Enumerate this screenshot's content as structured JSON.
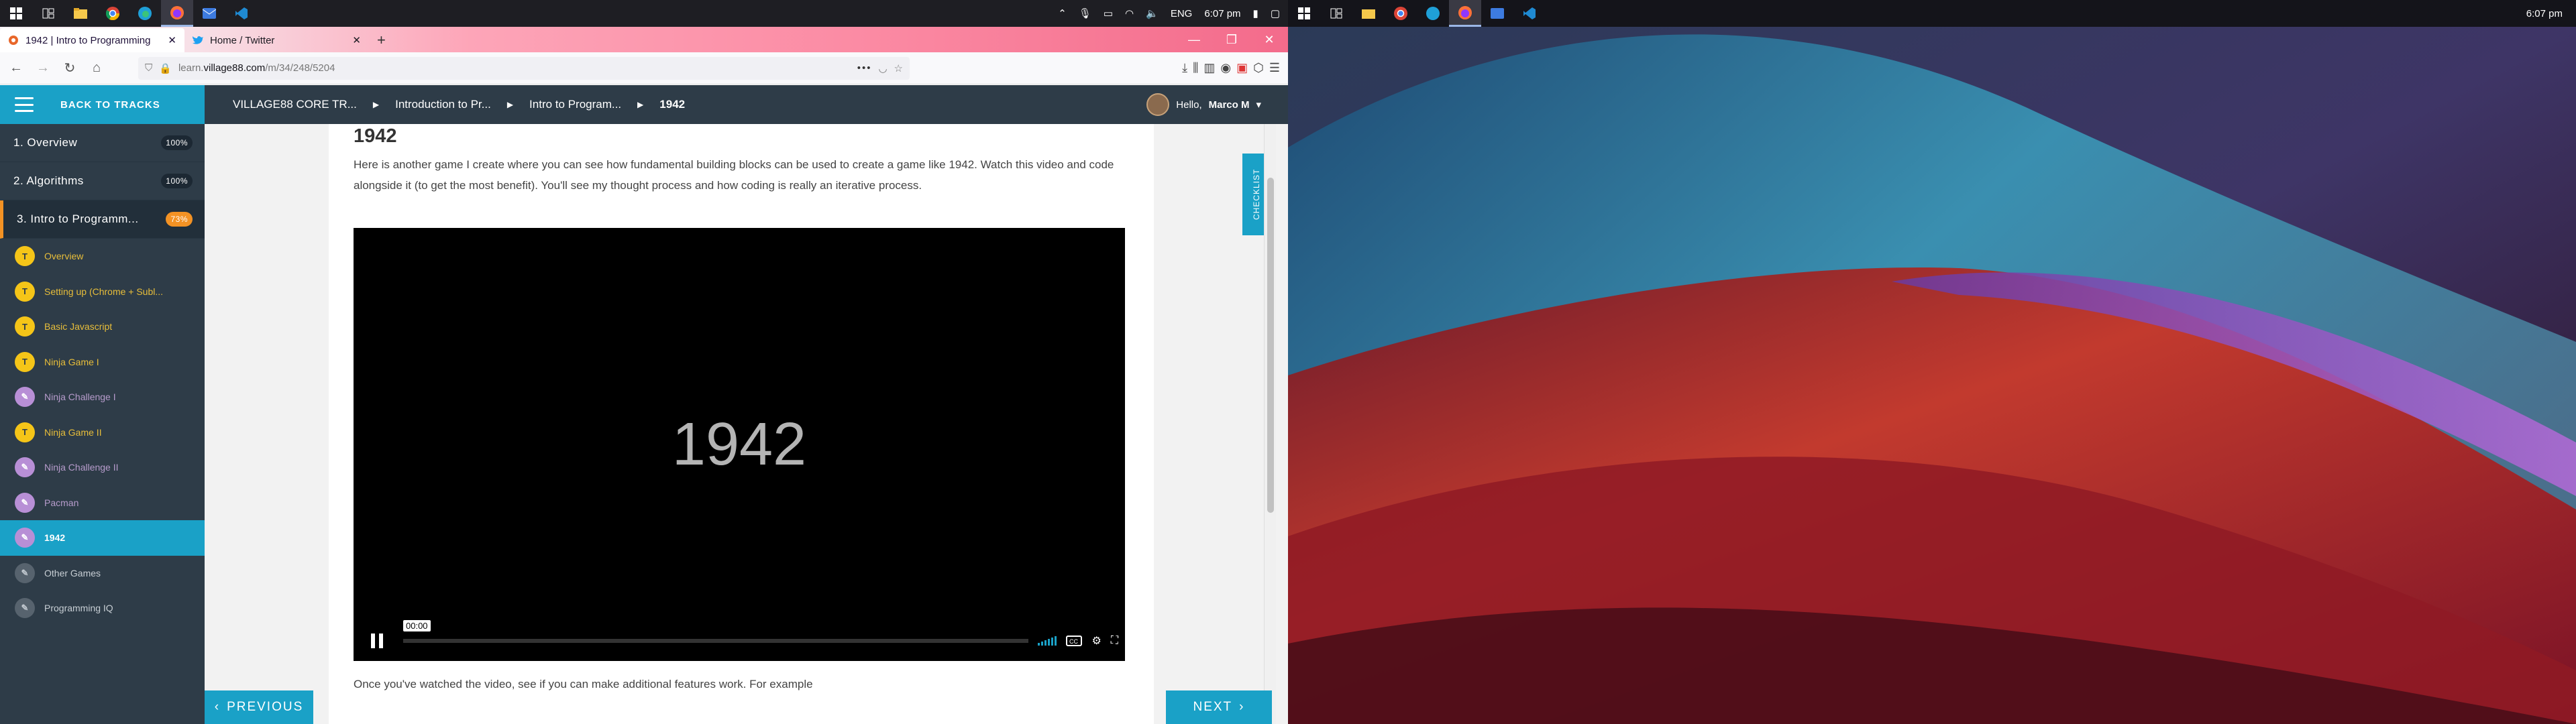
{
  "taskbar_left": {
    "apps": [
      "windows-icon",
      "task-view-icon",
      "file-explorer-icon",
      "chrome-icon",
      "edge-icon",
      "firefox-icon",
      "mail-icon",
      "vscode-icon"
    ],
    "lang": "ENG",
    "time": "6:07 pm"
  },
  "browser": {
    "tabs": [
      {
        "title": "1942 | Intro to Programming"
      },
      {
        "title": "Home / Twitter"
      }
    ],
    "url_prefix": "learn.",
    "url_host": "village88.com",
    "url_path": "/m/34/248/5204"
  },
  "sidebar": {
    "back_label": "BACK TO TRACKS",
    "sections": [
      {
        "label": "1. Overview",
        "pct": "100%"
      },
      {
        "label": "2. Algorithms",
        "pct": "100%"
      },
      {
        "label": "3. Intro to Programm...",
        "pct": "73%"
      }
    ],
    "items": [
      {
        "label": "Overview"
      },
      {
        "label": "Setting up (Chrome + Subl..."
      },
      {
        "label": "Basic Javascript"
      },
      {
        "label": "Ninja Game I"
      },
      {
        "label": "Ninja Challenge I"
      },
      {
        "label": "Ninja Game II"
      },
      {
        "label": "Ninja Challenge II"
      },
      {
        "label": "Pacman"
      },
      {
        "label": "1942"
      },
      {
        "label": "Other Games"
      },
      {
        "label": "Programming IQ"
      }
    ]
  },
  "topnav": {
    "crumbs": [
      "VILLAGE88 CORE TR...",
      "Introduction to Pr...",
      "Intro to Program...",
      "1942"
    ],
    "greeting": "Hello,",
    "user": "Marco M"
  },
  "lesson": {
    "title": "1942",
    "description": "Here is another game I create where you can see how fundamental building blocks can be used to create a game like 1942.  Watch this video and code alongside it (to get the most benefit).  You'll see my thought process and how coding is really an iterative process.",
    "video_title": "1942",
    "video_time": "00:00",
    "below_text": "Once you've watched the video, see if you can make additional features work.  For example",
    "checklist_label": "CHECKLIST"
  },
  "footer": {
    "prev_label": "PREVIOUS",
    "next_label": "NEXT"
  },
  "taskbar_right": {
    "time": "6:07 pm"
  }
}
